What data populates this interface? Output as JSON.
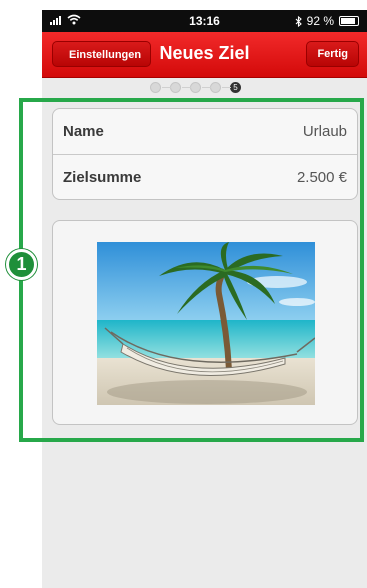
{
  "status_bar": {
    "time": "13:16",
    "battery_percent": "92 %",
    "icons": [
      "signal-bars-icon",
      "wifi-icon",
      "bluetooth-icon",
      "battery-icon"
    ]
  },
  "nav": {
    "back_label": "Einstellungen",
    "title": "Neues Ziel",
    "done_label": "Fertig"
  },
  "page_indicator": {
    "total": 5,
    "current": 5,
    "current_label": "5"
  },
  "form": {
    "rows": [
      {
        "label": "Name",
        "value": "Urlaub"
      },
      {
        "label": "Zielsumme",
        "value": "2.500 €"
      }
    ]
  },
  "image": {
    "icon": "beach-hammock-photo"
  },
  "annotation": {
    "number": "1"
  },
  "colors": {
    "nav_red": "#e31b1b",
    "highlight_green": "#27a84a",
    "background_gray": "#ebebeb"
  }
}
